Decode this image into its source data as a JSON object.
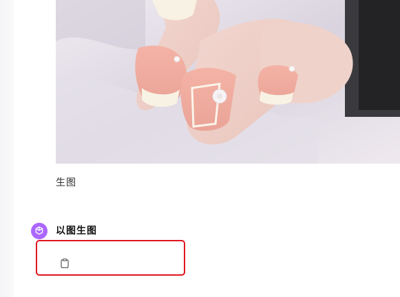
{
  "message": {
    "image_caption": "生图"
  },
  "assistant": {
    "name": "以图生图",
    "avatar_icon": "openai-logo-icon",
    "avatar_color": "#ab68ff"
  },
  "response": {
    "copy_icon": "clipboard-icon",
    "highlight_color": "#e0141e"
  }
}
